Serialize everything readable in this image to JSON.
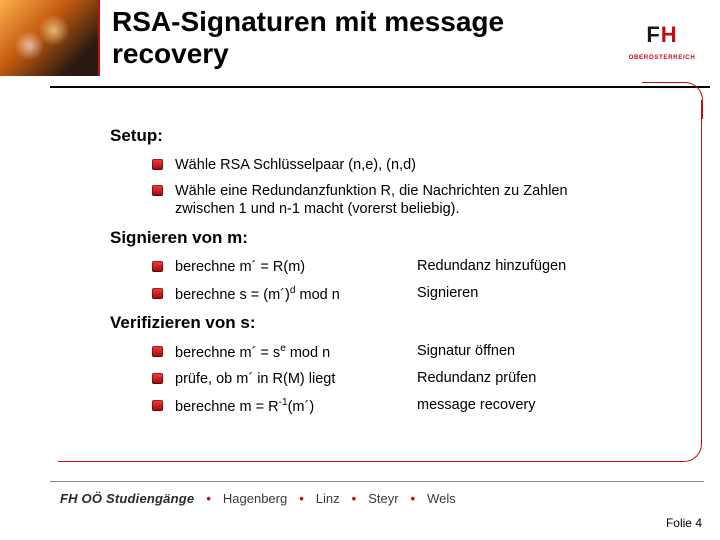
{
  "title": "RSA-Signaturen mit message recovery",
  "logo": {
    "letters": "FH",
    "sub": "OBERÖSTERREICH"
  },
  "sections": {
    "setup": {
      "heading": "Setup:",
      "items": [
        "Wähle RSA Schlüsselpaar (n,e), (n,d)",
        "Wähle eine Redundanzfunktion R, die Nachrichten zu Zahlen zwischen 1 und n-1 macht (vorerst beliebig)."
      ]
    },
    "sign": {
      "heading": "Signieren von m:",
      "rows": [
        {
          "left": "berechne m´ = R(m)",
          "right": "Redundanz hinzufügen"
        },
        {
          "left_html": "berechne s = (m´)<sup>d</sup> mod n",
          "right": "Signieren"
        }
      ]
    },
    "verify": {
      "heading": "Verifizieren von s:",
      "rows": [
        {
          "left_html": "berechne m´ = s<sup>e</sup> mod n",
          "right": "Signatur öffnen"
        },
        {
          "left": "prüfe, ob m´ in R(M) liegt",
          "right": "Redundanz prüfen"
        },
        {
          "left_html": "berechne m = R<sup>-1</sup>(m´)",
          "right": "message recovery"
        }
      ]
    }
  },
  "footer": {
    "brand": "FH OÖ Studiengänge",
    "locations": [
      "Hagenberg",
      "Linz",
      "Steyr",
      "Wels"
    ]
  },
  "folio": "Folie 4"
}
